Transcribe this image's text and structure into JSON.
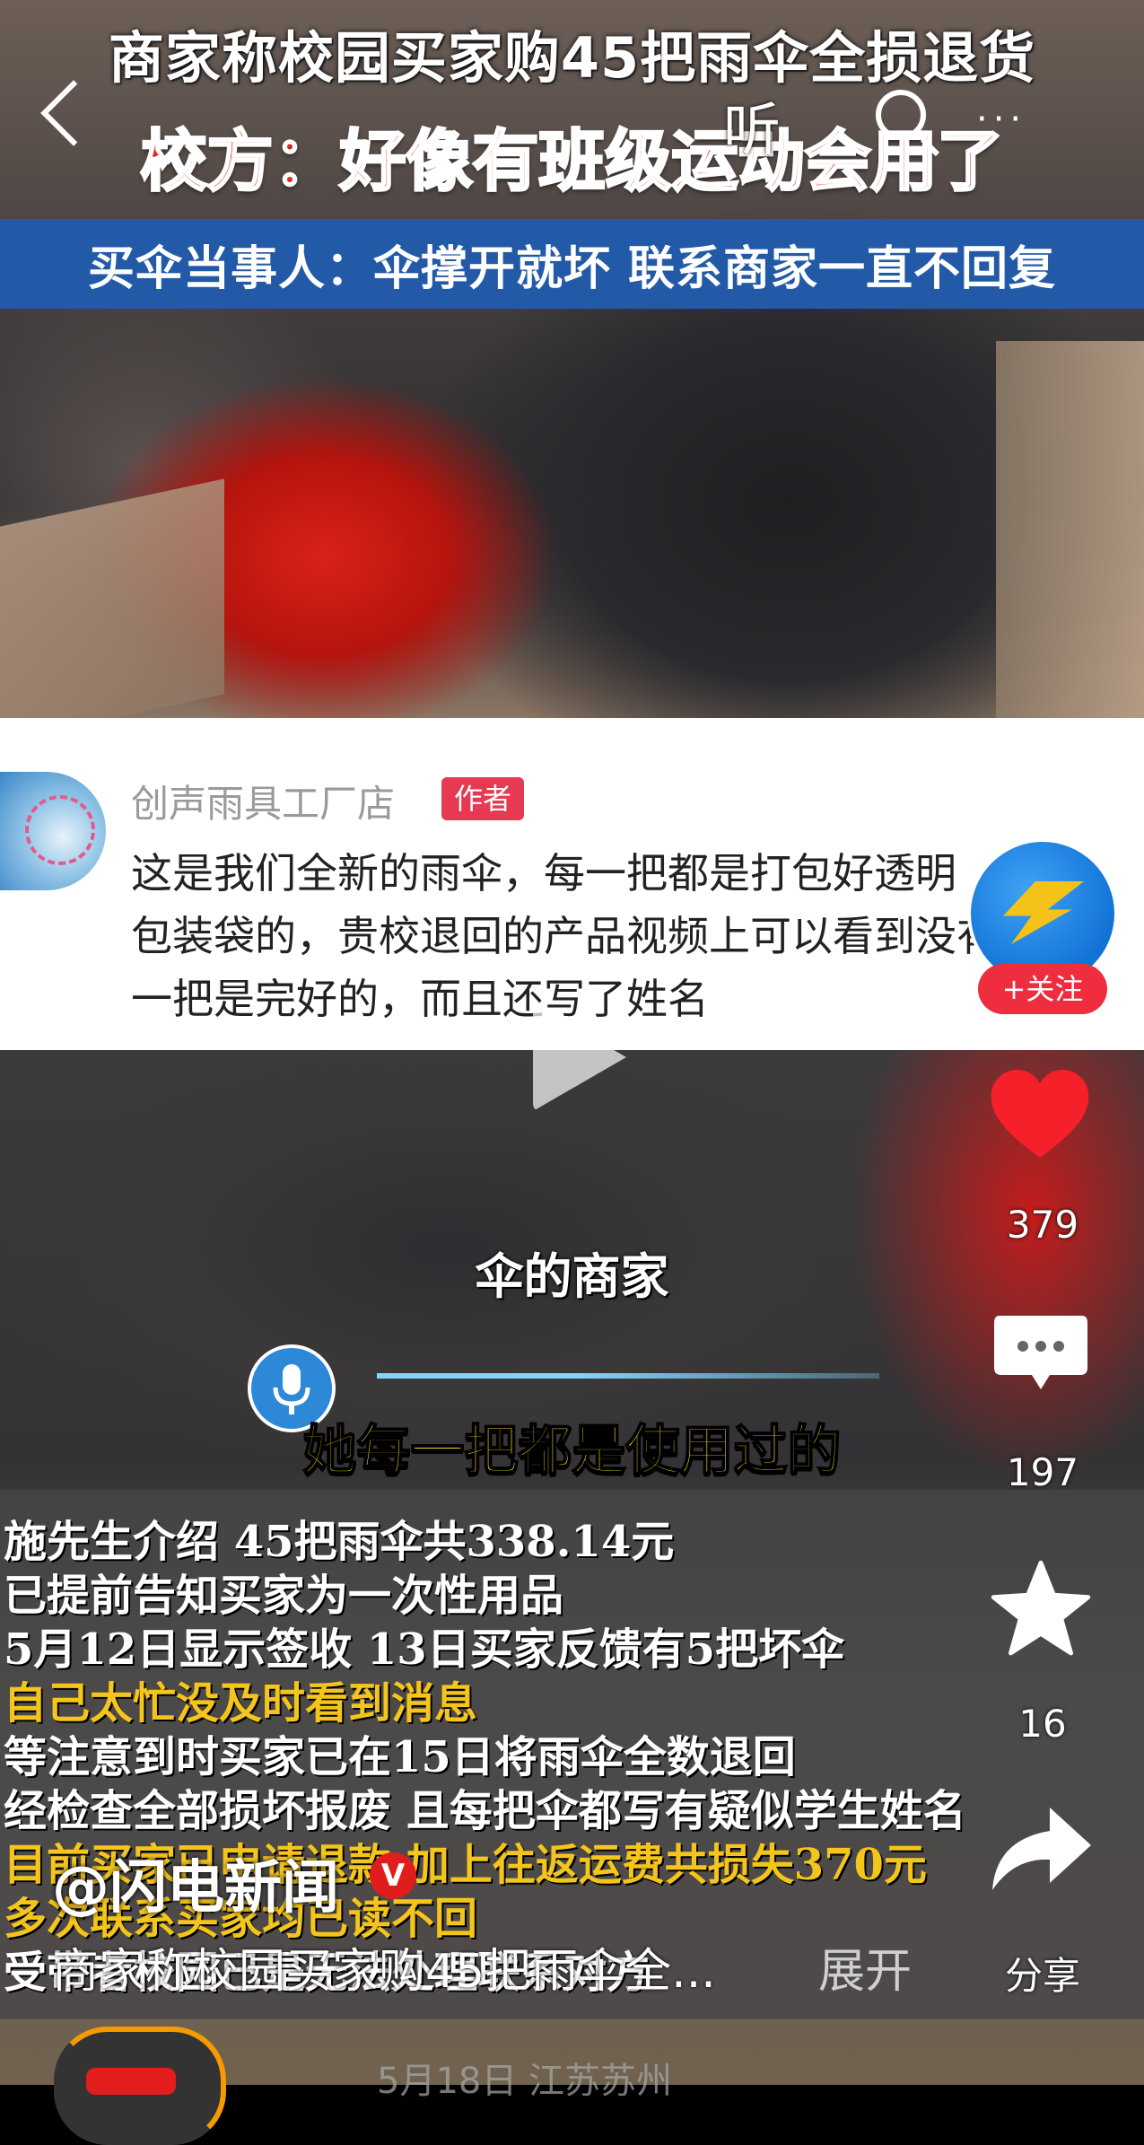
{
  "video_top": {
    "headline_1": "商家称校园买家购45把雨伞全损退货",
    "headline_2": "校方：好像有班级运动会用了",
    "headline_3": "买伞当事人：伞撑开就坏 联系商家一直不回复"
  },
  "nav": {
    "listen_label": "听",
    "more_label": "···"
  },
  "comment": {
    "shop_name": "创声雨具工厂店",
    "author_badge": "作者",
    "text": "这是我们全新的雨伞，每一把都是打包好透明\n包装袋的，贵校退回的产品视频上可以看到没有\n一把是完好的，而且还写了姓名"
  },
  "video_bottom": {
    "caption_mid": "伞的商家",
    "caption_yellow": "她每一把都是使用过的",
    "info_lines": [
      {
        "text": "施先生介绍 45把雨伞共338.14元",
        "color": "white"
      },
      {
        "text": "已提前告知买家为一次性用品",
        "color": "white"
      },
      {
        "text": "5月12日显示签收 13日买家反馈有5把坏伞",
        "color": "white"
      },
      {
        "text": "自己太忙没及时看到消息",
        "color": "yellow"
      },
      {
        "text": "等注意到时买家已在15日将雨伞全数退回",
        "color": "white"
      },
      {
        "text": "经检查全部损坏报废 且每把伞都写有疑似学生姓名",
        "color": "white"
      },
      {
        "text": "目前买家已申请退款 加上往返运费共损失370元",
        "color": "yellow"
      },
      {
        "text": "多次联系买家均已读不回",
        "color": "yellow"
      },
      {
        "text": "受带者校园已是无法处理联系对方",
        "color": "white"
      }
    ]
  },
  "sidebar": {
    "follow_label": "+关注",
    "like_count": "379",
    "comment_count": "197",
    "favorite_count": "16",
    "share_label": "分享"
  },
  "footer": {
    "author_handle": "@闪电新闻",
    "verified_mark": "V",
    "description": "商家称校园买家购45把雨伞全...",
    "expand_label": "展开",
    "bottom_text": "5月18日 江苏苏州"
  },
  "colors": {
    "accent_red": "#e63a52",
    "headline_blue": "#235aa8",
    "caption_yellow": "#f6d31a"
  },
  "icons": [
    "back-icon",
    "search-icon",
    "more-icon",
    "play-icon",
    "heart-icon",
    "comment-icon",
    "star-icon",
    "share-icon",
    "mic-icon",
    "verified-icon"
  ]
}
